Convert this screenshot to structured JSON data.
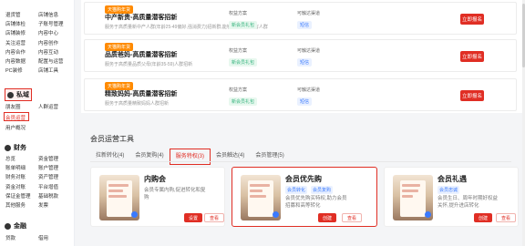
{
  "sidebar": {
    "group1": [
      "退货管",
      "店铺信息",
      "店铺体检",
      "子账号管理",
      "店铺装修",
      "内容中心",
      "关注运营",
      "内容创作",
      "内容合作",
      "内容互动",
      "内容数据",
      "配置与运营",
      "PC装修",
      "店铺工具"
    ],
    "section_private": "私域",
    "group2": [
      "朋友圈",
      "人群运营"
    ],
    "member_ops": "会员运营",
    "users": "用户概况",
    "section_finance": "财务",
    "group3": [
      "总览",
      "资金管理",
      "账单明细",
      "账户管理",
      "财务对账",
      "资产管理",
      "资金对账",
      "平台增值",
      "保证金管理",
      "基础税款",
      "其他服务",
      "发票"
    ],
    "section_finance2": "金融",
    "group4": [
      "贷款",
      "借用"
    ]
  },
  "campaigns": [
    {
      "tag": "天猫购年货",
      "title": "中产新贵-高质量潜客招新",
      "desc": "服务于高质量新中产人群(年龄25-49偏好,强消费力)招新群,能够快速锁定潜客人群",
      "rights_label": "权益方案",
      "rights": "新会员礼包",
      "channel_label": "可触达渠道",
      "channel": "短信",
      "button": "立即报名"
    },
    {
      "tag": "天猫购年货",
      "title": "品质爸妈-高质量潜客招新",
      "desc": "服务于高质量品质父母(年龄35-59)人群招新",
      "rights_label": "权益方案",
      "rights": "新会员礼包",
      "channel_label": "可触达渠道",
      "channel": "短信",
      "button": "立即报名"
    },
    {
      "tag": "天猫购年货",
      "title": "精致妈妈-高质量潜客招新",
      "desc": "服务于高质量精致妈妈人群招新",
      "rights_label": "权益方案",
      "rights": "新会员礼包",
      "channel_label": "可触达渠道",
      "channel": "短信",
      "button": "立即报名"
    }
  ],
  "tools": {
    "title": "会员运营工具",
    "tabs": [
      "拉新转化(4)",
      "会员复购(4)",
      "服务特权(3)",
      "会员触达(4)",
      "会员管理(5)"
    ],
    "active_tab": "服务特权(3)",
    "cards": [
      {
        "name": "内购会",
        "chips": [],
        "desc": "会员专属内购,促进转化和复购",
        "btn_create": "设置",
        "btn_view": "查看"
      },
      {
        "name": "会员优先购",
        "chips": [
          "会员转化",
          "会员复购"
        ],
        "desc": "会员优先购买特权,助力会员招募和高等转化",
        "btn_create": "创建",
        "btn_view": "查看"
      },
      {
        "name": "会员礼遇",
        "chips": [
          "会员忠诚"
        ],
        "desc": "会员生日、周年时期好权益关怀,提升进店转化",
        "btn_create": "创建",
        "btn_view": "查看"
      }
    ]
  },
  "colors": {
    "accent": "#e02e24",
    "tag": "#ff8a00",
    "green": "#36b37e",
    "blue": "#3a7afe"
  }
}
